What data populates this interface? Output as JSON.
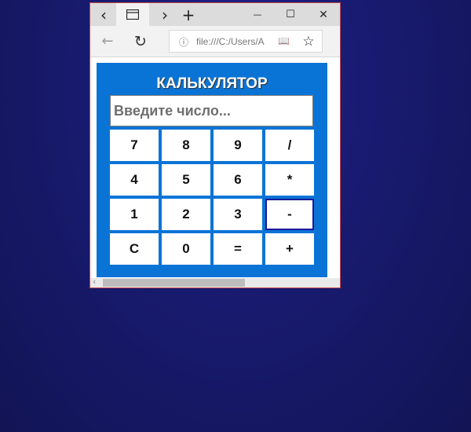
{
  "browser": {
    "tabbar": {
      "back_tab_glyph": "‹",
      "tab_icon": "tab-page-icon",
      "forward_tab_glyph": "›",
      "new_tab_glyph": "+",
      "minimize_glyph": "—",
      "maximize_glyph": "☐",
      "close_glyph": "✕"
    },
    "addressbar": {
      "back_glyph": "←",
      "refresh_glyph": "↻",
      "info_glyph": "ⓘ",
      "url": "file:///C:/Users/A",
      "reading_glyph": "📖",
      "favorite_glyph": "☆"
    }
  },
  "calculator": {
    "title": "КАЛЬКУЛЯТОР",
    "input": {
      "value": "",
      "placeholder": "Введите число..."
    },
    "keys": [
      {
        "label": "7"
      },
      {
        "label": "8"
      },
      {
        "label": "9"
      },
      {
        "label": "/"
      },
      {
        "label": "4"
      },
      {
        "label": "5"
      },
      {
        "label": "6"
      },
      {
        "label": "*"
      },
      {
        "label": "1"
      },
      {
        "label": "2"
      },
      {
        "label": "3"
      },
      {
        "label": "-"
      },
      {
        "label": "C"
      },
      {
        "label": "0"
      },
      {
        "label": "="
      },
      {
        "label": "+"
      }
    ],
    "colors": {
      "panel": "#0a74d6",
      "key": "#ffffff",
      "focused_border": "#1a1a9a"
    }
  }
}
